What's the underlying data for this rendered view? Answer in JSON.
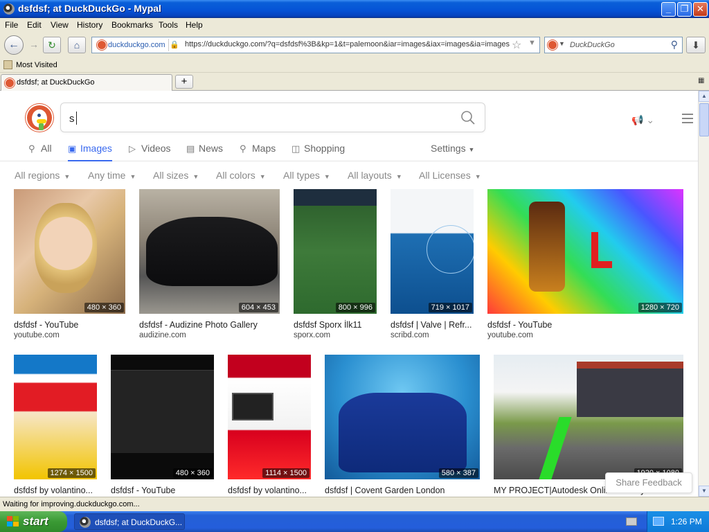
{
  "window": {
    "title": "dsfdsf; at DuckDuckGo - Mypal",
    "controls": {
      "minimize": "_",
      "maximize": "❐",
      "close": "✕"
    }
  },
  "menu": [
    "File",
    "Edit",
    "View",
    "History",
    "Bookmarks",
    "Tools",
    "Help"
  ],
  "toolbar": {
    "site_badge": "duckduckgo.com",
    "url": "https://duckduckgo.com/?q=dsfdsf%3B&kp=1&t=palemoon&iar=images&iax=images&ia=images",
    "search_placeholder": "DuckDuckGo"
  },
  "bookmarks": {
    "most_visited": "Most Visited"
  },
  "tab": {
    "label": "dsfdsf; at DuckDuckGo",
    "new": "+"
  },
  "ddg": {
    "query": "s",
    "tabs": [
      {
        "label": "All",
        "icon": "search-icon"
      },
      {
        "label": "Images",
        "icon": "image-icon"
      },
      {
        "label": "Videos",
        "icon": "play-icon"
      },
      {
        "label": "News",
        "icon": "news-icon"
      },
      {
        "label": "Maps",
        "icon": "map-pin-icon"
      },
      {
        "label": "Shopping",
        "icon": "shopping-bag-icon"
      }
    ],
    "settings": "Settings",
    "filters": [
      "All regions",
      "Any time",
      "All sizes",
      "All colors",
      "All types",
      "All layouts",
      "All Licenses"
    ],
    "results": [
      {
        "title": "dsfdsf - YouTube",
        "domain": "youtube.com",
        "dims": "480 × 360"
      },
      {
        "title": "dsfdsf - Audizine Photo Gallery",
        "domain": "audizine.com",
        "dims": "604 × 453"
      },
      {
        "title": "dsfdsf Sporx İlk11",
        "domain": "sporx.com",
        "dims": "800 × 996"
      },
      {
        "title": "dsfdsf | Valve | Refr...",
        "domain": "scribd.com",
        "dims": "719 × 1017"
      },
      {
        "title": "dsfdsf - YouTube",
        "domain": "youtube.com",
        "dims": "1280 × 720"
      },
      {
        "title": "dsfdsf by volantino...",
        "domain": "",
        "dims": "1274 × 1500"
      },
      {
        "title": "dsfdsf - YouTube",
        "domain": "",
        "dims": "480 × 360"
      },
      {
        "title": "dsfdsf by volantino...",
        "domain": "",
        "dims": "1114 × 1500"
      },
      {
        "title": "dsfdsf | Covent Garden London",
        "domain": "",
        "dims": "580 × 387"
      },
      {
        "title": "MY PROJECT|Autodesk Online Gallery",
        "domain": "",
        "dims": "1920 × 1080"
      }
    ],
    "share_feedback": "Share Feedback"
  },
  "status": "Waiting for improving.duckduckgo.com...",
  "taskbar": {
    "start": "start",
    "item": "dsfdsf; at DuckDuckG...",
    "clock": "1:26 PM"
  },
  "colors": {
    "accent": "#3969ef",
    "ddg_orange": "#de5833",
    "xp_blue": "#0553d6"
  }
}
